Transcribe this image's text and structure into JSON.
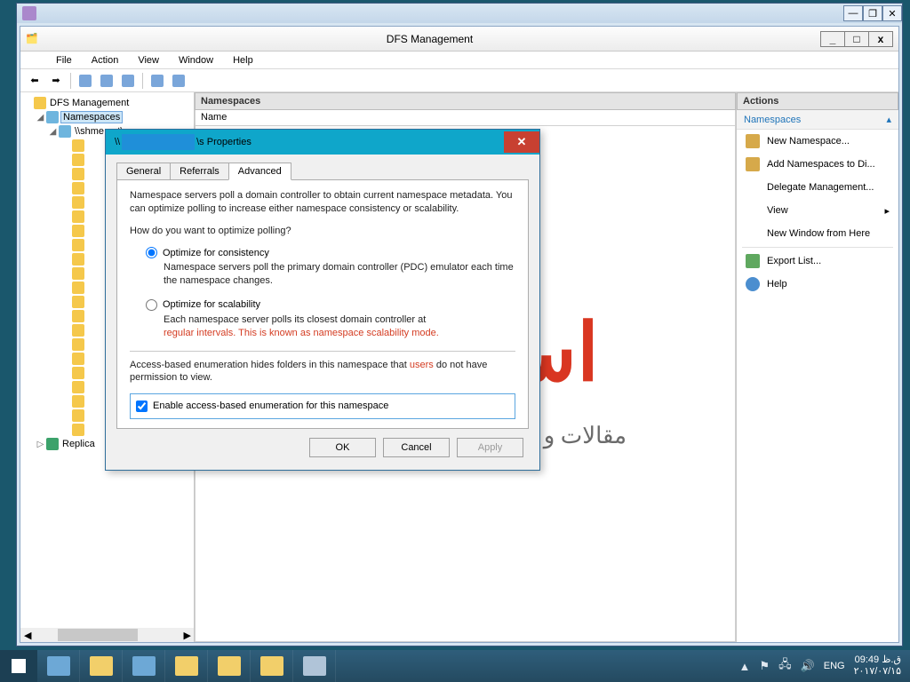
{
  "outer_window": {
    "min": "—",
    "restore": "❐",
    "close": "✕"
  },
  "app_title": "DFS Management",
  "window_controls": {
    "min": "_",
    "max": "□",
    "close": "x"
  },
  "menu": [
    "File",
    "Action",
    "View",
    "Window",
    "Help"
  ],
  "tree": {
    "root": "DFS Management",
    "namespaces": "Namespaces",
    "ns_server": "\\\\shme.net\\s",
    "replication": "Replica"
  },
  "center": {
    "header": "Namespaces",
    "col_name": "Name",
    "first_row": "\\\\"
  },
  "actions": {
    "header": "Actions",
    "group": "Namespaces",
    "items": [
      "New Namespace...",
      "Add Namespaces to Di...",
      "Delegate Management...",
      "View",
      "New Window from Here",
      "Export List...",
      "Help"
    ]
  },
  "dialog": {
    "title_prefix": "\\\\",
    "title_suffix": "\\s Properties",
    "tabs": [
      "General",
      "Referrals",
      "Advanced"
    ],
    "intro": "Namespace servers poll a domain controller to obtain current namespace metadata. You can optimize polling to increase either namespace consistency or scalability.",
    "question": "How do you want to optimize polling?",
    "opt1": "Optimize for consistency",
    "opt1_desc": "Namespace servers poll the primary domain controller (PDC) emulator each time the namespace changes.",
    "opt2": "Optimize for scalability",
    "opt2_desc_a": "Each namespace server polls its closest domain controller at ",
    "opt2_desc_b": "regular intervals. This is known as namespace scalability mode.",
    "abe_desc_a": "Access-based enumeration hides folders in this namespace that ",
    "abe_desc_b": "users",
    "abe_desc_c": " do not have permission to view.",
    "abe_check": "Enable access-based enumeration for this namespace",
    "btn_ok": "OK",
    "btn_cancel": "Cancel",
    "btn_apply": "Apply"
  },
  "watermark": {
    "main": "استادشبـ",
    "sub": "مقالات و آموزشهای تخصصی شبと"
  },
  "taskbar": {
    "lang": "ENG",
    "time": "ق.ظ 09:49",
    "date": "۲۰۱۷/۰۷/۱۵",
    "tray_up": "▲",
    "tray_flag": "⚑",
    "tray_net": "🖧",
    "tray_vol": "🔊"
  }
}
